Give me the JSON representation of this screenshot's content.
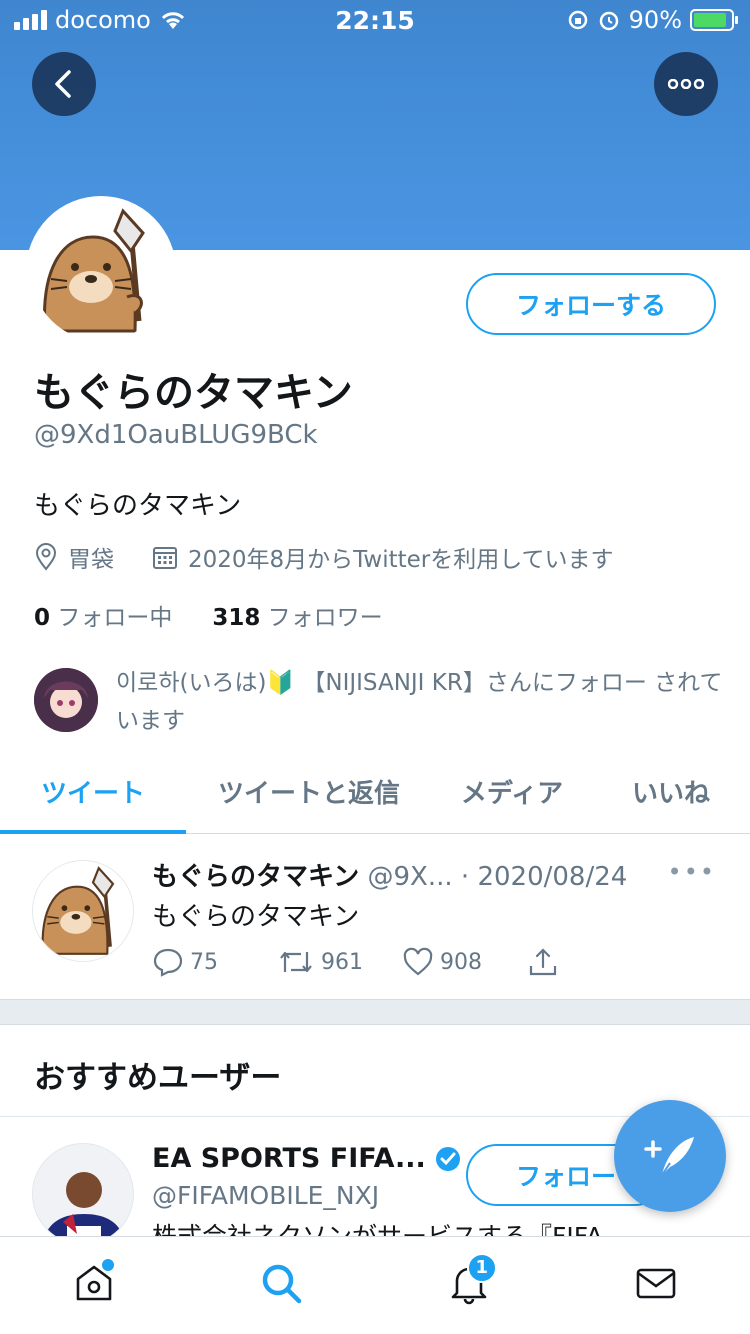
{
  "status_bar": {
    "carrier": "docomo",
    "time": "22:15",
    "battery": "90%"
  },
  "profile": {
    "name": "もぐらのタマキン",
    "handle": "@9Xd1OauBLUG9BCk",
    "bio": "もぐらのタマキン",
    "location": "胃袋",
    "joined": "2020年8月からTwitterを利用しています",
    "following_count": "0",
    "following_label": "フォロー中",
    "followers_count": "318",
    "followers_label": "フォロワー",
    "follow_button": "フォローする",
    "followed_by": "이로하(いろは)🔰 【NIJISANJI KR】さんにフォロー されています"
  },
  "tabs": [
    "ツイート",
    "ツイートと返信",
    "メディア",
    "いいね"
  ],
  "tweet": {
    "name": "もぐらのタマキン",
    "handle": "@9X...",
    "date": "· 2020/08/24",
    "text": "もぐらのタマキン",
    "replies": "75",
    "retweets": "961",
    "likes": "908"
  },
  "recommend": {
    "title": "おすすめユーザー",
    "user": {
      "name": "EA SPORTS FIFA...",
      "handle": "@FIFAMOBILE_NXJ",
      "desc": "株式会社ネクソンがサービスする『FIFA",
      "follow": "フォロー"
    }
  },
  "notifications_badge": "1",
  "colors": {
    "accent": "#1da1f2",
    "banner": "#4a95e3"
  },
  "icons": [
    "back-icon",
    "more-icon",
    "location-icon",
    "calendar-icon",
    "reply-icon",
    "retweet-icon",
    "like-icon",
    "share-icon",
    "compose-icon",
    "home-icon",
    "search-icon",
    "bell-icon",
    "mail-icon"
  ]
}
